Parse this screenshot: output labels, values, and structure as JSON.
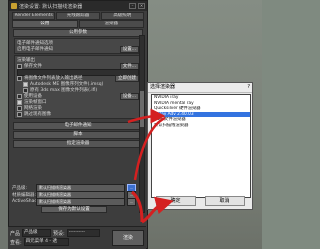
{
  "dialog": {
    "title": "渲染设置: 默认扫描线渲染器",
    "tabs_top": [
      "Render Elements",
      "光线跟踪器",
      "高级照明"
    ],
    "tabs_bottom": [
      "公用",
      "渲染器"
    ],
    "rollout_common": "公用参数",
    "email_section": {
      "options_label": "电子邮件通知选项",
      "save_notify_label": "启用电子邮件通知",
      "btn_label": "设置..."
    },
    "render_output": {
      "heading": "渲染输出",
      "save_file_label": "保存文件",
      "files_btn": "文件...",
      "device_label": "将图像文件列表放入输出路径",
      "create_now_btn": "立即创建",
      "autodesk_label": "Autodesk ME 图像序列文件(.imsq)",
      "legacy_label": "原有 3ds max 图像文件列表(.ifl)",
      "use_device_label": "使用设备",
      "devices_btn": "设备...",
      "frame_window_label": "渲染帧窗口",
      "net_render_label": "网络渲染",
      "skip_label": "跳过现有图像"
    },
    "rollouts": [
      "电子邮件通知",
      "脚本",
      "指定渲染器"
    ],
    "assign": {
      "production_label": "产品级:",
      "production_value": "默认扫描线渲染器",
      "material_label": "材质编辑器:",
      "material_value": "默认扫描线渲染器",
      "activeshade_label": "ActiveShade:",
      "activeshade_value": "默认扫描线渲染器",
      "dots": "...",
      "save_defaults_btn": "保存为默认设置"
    },
    "bottom": {
      "product_label": "产品",
      "product_value": "产品级",
      "preset_label": "预设:",
      "preset_value": "----------",
      "view_label": "查看:",
      "view_value": "四元菜单 4 - 透",
      "render_btn": "渲染"
    }
  },
  "choose_dialog": {
    "title": "选择渲染器",
    "close": "?",
    "items": [
      {
        "label": "NVIDIA iray",
        "selected": false
      },
      {
        "label": "NVIDIA mental ray",
        "selected": false
      },
      {
        "label": "Quicksilver 硬件渲染器",
        "selected": false
      },
      {
        "label": "V-Ray Adv 2.40.03",
        "selected": true
      },
      {
        "label": "VUE 文件渲染器",
        "selected": false
      },
      {
        "label": "默认扫描线渲染器",
        "selected": false
      }
    ],
    "ok_label": "确定",
    "cancel_label": "取消"
  },
  "colors": {
    "highlight": "#3373e0",
    "arrow": "#d42020"
  }
}
